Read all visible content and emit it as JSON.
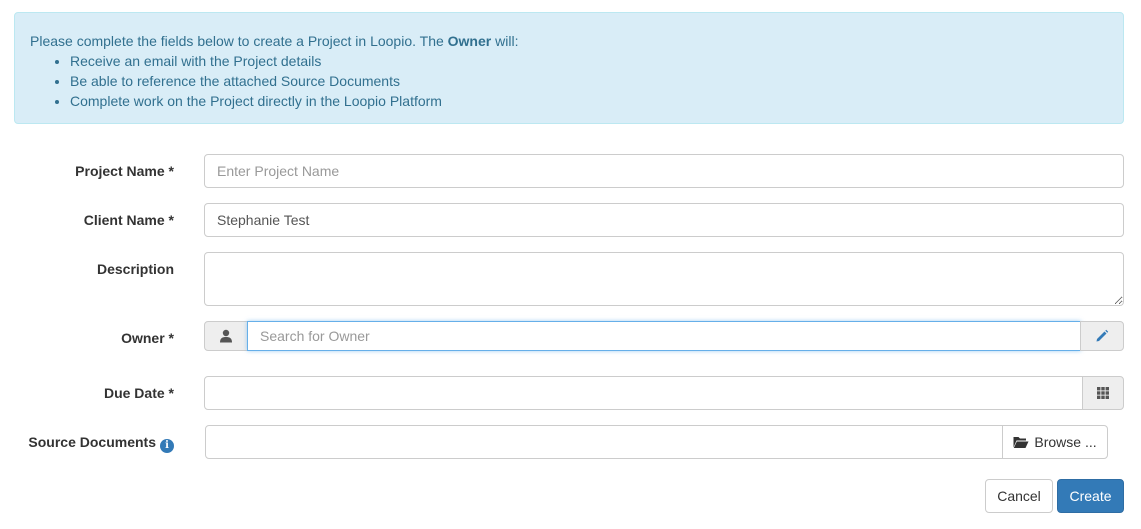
{
  "intro": {
    "text_before": "Please complete the fields below to create a Project in Loopio. The ",
    "strong": "Owner",
    "text_after": " will:",
    "bullets": [
      "Receive an email with the Project details",
      "Be able to reference the attached Source Documents",
      "Complete work on the Project directly in the Loopio Platform"
    ]
  },
  "form": {
    "project_name": {
      "label": "Project Name *",
      "placeholder": "Enter Project Name",
      "value": ""
    },
    "client_name": {
      "label": "Client Name *",
      "value": "Stephanie Test"
    },
    "description": {
      "label": "Description",
      "value": ""
    },
    "owner": {
      "label": "Owner *",
      "placeholder": "Search for Owner",
      "value": "",
      "icon": "user-icon",
      "edit_icon": "pencil-icon"
    },
    "due_date": {
      "label": "Due Date *",
      "value": "",
      "icon": "calendar-grid-icon"
    },
    "source_documents": {
      "label": "Source Documents",
      "info_icon": "info-icon",
      "browse_label": "Browse ...",
      "browse_icon": "folder-open-icon"
    }
  },
  "actions": {
    "cancel_label": "Cancel",
    "create_label": "Create"
  },
  "colors": {
    "primary": "#337ab7",
    "alert_bg": "#d9edf7",
    "alert_text": "#31708f",
    "focus_border": "#66afe9"
  }
}
